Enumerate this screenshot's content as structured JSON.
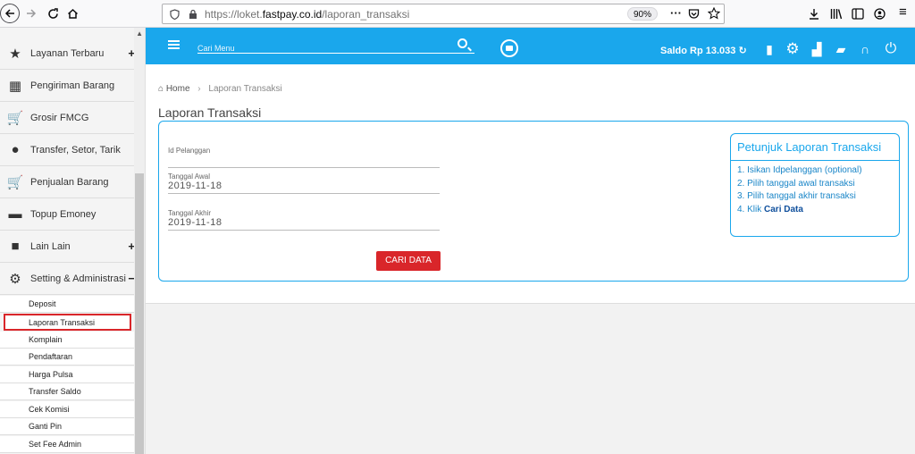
{
  "browser": {
    "url_prefix": "https://loket.",
    "url_domain": "fastpay.co.id",
    "url_path": "/laporan_transaksi",
    "zoom": "90%"
  },
  "sidebar": {
    "items": [
      {
        "label": "Layanan Terbaru",
        "icon": "star-icon",
        "expand": "+"
      },
      {
        "label": "Pengiriman Barang",
        "icon": "package-icon",
        "expand": ""
      },
      {
        "label": "Grosir FMCG",
        "icon": "cart-icon",
        "expand": ""
      },
      {
        "label": "Transfer, Setor, Tarik",
        "icon": "coins-icon",
        "expand": ""
      },
      {
        "label": "Penjualan Barang",
        "icon": "cart-plus-icon",
        "expand": ""
      },
      {
        "label": "Topup Emoney",
        "icon": "card-icon",
        "expand": ""
      },
      {
        "label": "Lain Lain",
        "icon": "grid-icon",
        "expand": "+"
      },
      {
        "label": "Setting & Administrasi",
        "icon": "gear-icon",
        "expand": "−"
      }
    ],
    "subitems": [
      "Deposit",
      "Laporan Transaksi",
      "Komplain",
      "Pendaftaran",
      "Harga Pulsa",
      "Transfer Saldo",
      "Cek Komisi",
      "Ganti Pin",
      "Set Fee Admin"
    ]
  },
  "topbar": {
    "search_placeholder": "Cari Menu",
    "saldo": "Saldo Rp 13.033"
  },
  "breadcrumb": {
    "home": "Home",
    "current": "Laporan Transaksi"
  },
  "page": {
    "title": "Laporan Transaksi"
  },
  "form": {
    "id_label": "Id Pelanggan",
    "id_value": "",
    "start_label": "Tanggal Awal",
    "start_value": "2019-11-18",
    "end_label": "Tanggal Akhir",
    "end_value": "2019-11-18",
    "submit": "CARI DATA"
  },
  "help": {
    "title": "Petunjuk Laporan Transaksi",
    "steps": [
      "1. Isikan Idpelanggan (optional)",
      "2. Pilih tanggal awal transaksi",
      "3. Pilih tanggal akhir transaksi"
    ],
    "step4_prefix": "4. Klik ",
    "step4_bold": "Cari Data"
  },
  "colors": {
    "accent": "#1aa7ec",
    "danger": "#d9262a"
  }
}
